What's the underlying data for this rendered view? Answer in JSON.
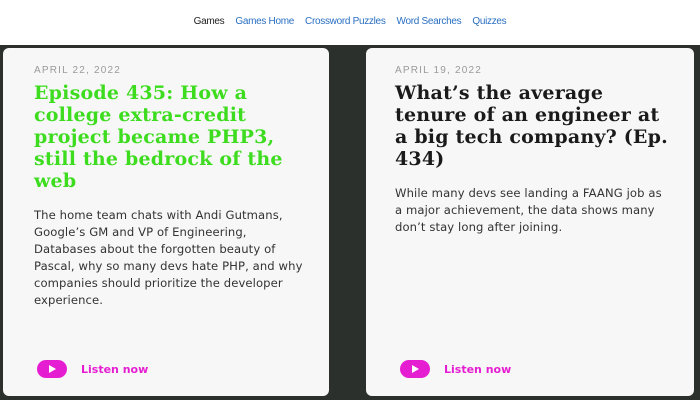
{
  "nav": {
    "items": [
      {
        "label": "Games",
        "active": true
      },
      {
        "label": "Games Home",
        "active": false
      },
      {
        "label": "Crossword Puzzles",
        "active": false
      },
      {
        "label": "Word Searches",
        "active": false
      },
      {
        "label": "Quizzes",
        "active": false
      }
    ]
  },
  "cards": [
    {
      "date": "APRIL 22, 2022",
      "title": "Episode 435: How a college extra-credit project became PHP3, still the bedrock of the web",
      "description": "The home team chats with Andi Gutmans, Google’s GM and VP of Engineering, Databases about the forgotten beauty of Pascal, why so many devs hate PHP, and why companies should prioritize the developer experience.",
      "listen_label": "Listen now",
      "icon": "play-icon"
    },
    {
      "date": "APRIL 19, 2022",
      "title": "What’s the average tenure of an engineer at a big tech company? (Ep. 434)",
      "description": "While many devs see landing a FAANG job as a major achievement, the data shows many don’t stay long after joining.",
      "listen_label": "Listen now",
      "icon": "play-icon"
    }
  ],
  "colors": {
    "background": "#2b302c",
    "card": "#f7f7f7",
    "accent_magenta": "#e61ed2",
    "highlight_green": "#3ddc1f",
    "nav_link": "#2a6fc2"
  }
}
